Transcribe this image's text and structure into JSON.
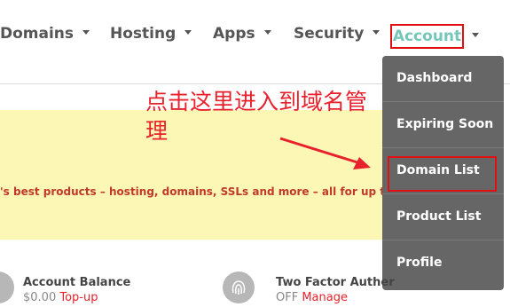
{
  "nav": {
    "items": [
      {
        "label": "Domains"
      },
      {
        "label": "Hosting"
      },
      {
        "label": "Apps"
      },
      {
        "label": "Security"
      }
    ],
    "account": {
      "label": "Account"
    }
  },
  "dropdown": {
    "items": [
      {
        "label": "Dashboard"
      },
      {
        "label": "Expiring Soon"
      },
      {
        "label": "Domain List"
      },
      {
        "label": "Product List"
      },
      {
        "label": "Profile"
      }
    ]
  },
  "banner": {
    "text": "'s best products – hosting, domains, SSLs and more – all for up to"
  },
  "annotation": {
    "text": "点击这里进入到域名管理"
  },
  "widgets": {
    "balance": {
      "title": "Account Balance",
      "value": "$0.00",
      "link": "Top-up"
    },
    "two_factor": {
      "title": "Two Factor Auther",
      "value": "OFF",
      "link": "Manage"
    }
  },
  "colors": {
    "accent": "#76c7b9",
    "highlight": "#e01010",
    "annotation": "#e8222c",
    "dropdown_bg": "#666666",
    "banner_bg": "#fdf7b6"
  }
}
